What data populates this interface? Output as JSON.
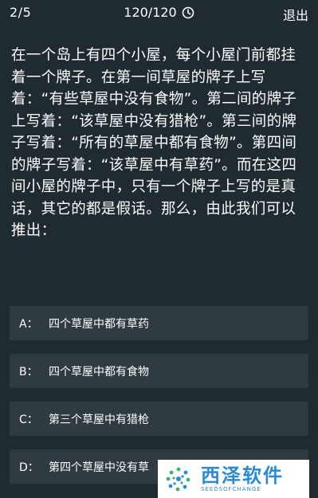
{
  "header": {
    "progress": "2/5",
    "timer": "120/120",
    "exit_label": "退出"
  },
  "question": {
    "text": "在一个岛上有四个小屋，每个小屋门前都挂着一个牌子。在第一间草屋的牌子上写着：“有些草屋中没有食物”。第二间的牌子上写着：“该草屋中没有猎枪”。第三间的牌子写着：“所有的草屋中都有食物”。第四间的牌子写着：“该草屋中有草药”。而在这四间小屋的牌子中，只有一个牌子上写的是真话，其它的都是假话。那么，由此我们可以推出："
  },
  "options": [
    {
      "letter": "A：",
      "text": "四个草屋中都有草药"
    },
    {
      "letter": "B：",
      "text": "四个草屋中都有食物"
    },
    {
      "letter": "C：",
      "text": "第三个草屋中有猎枪"
    },
    {
      "letter": "D：",
      "text": "第四个草屋中没有草"
    }
  ],
  "watermark": {
    "title": "西泽软件",
    "subtitle": "SEEDSOFCHANGE"
  },
  "colors": {
    "background": "#1f2a31",
    "option_bg": "#2f3a41",
    "watermark_blue": "#2b8ad6",
    "watermark_green": "#3cb371"
  },
  "icons": {
    "timer": "clock-icon",
    "logo": "watermark-logo-icon"
  }
}
